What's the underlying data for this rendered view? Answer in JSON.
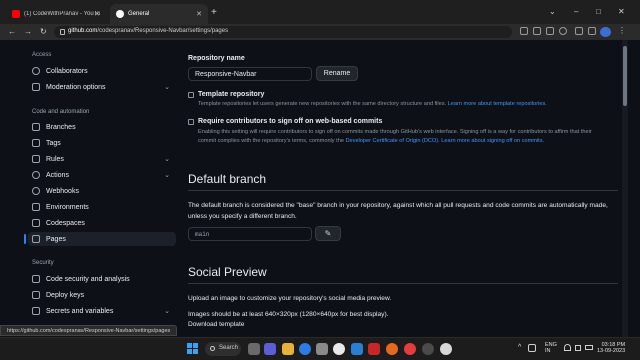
{
  "browser": {
    "tabs": [
      {
        "title": "(1) CodeWithPranav - YouTube",
        "fav": "youtube-icon",
        "color": "#ff0000"
      },
      {
        "title": "General",
        "fav": "github-icon",
        "color": "#ffffff"
      }
    ],
    "new_tab": "+",
    "window_controls": {
      "restore": "⌄",
      "minimize": "–",
      "maximize": "□",
      "close": "✕"
    },
    "nav": {
      "back": "←",
      "forward": "→",
      "reload": "↻"
    },
    "url_host": "github.com",
    "url_path": "/codespranav/Responsive-Navbar/settings/pages",
    "menu": "⋮"
  },
  "sidebar": {
    "access_heading": "Access",
    "code_heading": "Code and automation",
    "security_heading": "Security",
    "items": [
      {
        "label": "Collaborators",
        "icon": "people-icon"
      },
      {
        "label": "Moderation options",
        "icon": "report-icon",
        "chevron": "⌄"
      },
      {
        "label": "Branches",
        "icon": "branch-icon"
      },
      {
        "label": "Tags",
        "icon": "tag-icon"
      },
      {
        "label": "Rules",
        "icon": "rules-icon",
        "chevron": "⌄"
      },
      {
        "label": "Actions",
        "icon": "play-icon",
        "chevron": "⌄"
      },
      {
        "label": "Webhooks",
        "icon": "webhook-icon"
      },
      {
        "label": "Environments",
        "icon": "server-icon"
      },
      {
        "label": "Codespaces",
        "icon": "codespaces-icon"
      },
      {
        "label": "Pages",
        "icon": "browser-icon"
      },
      {
        "label": "Code security and analysis",
        "icon": "shield-icon"
      },
      {
        "label": "Deploy keys",
        "icon": "key-icon"
      },
      {
        "label": "Secrets and variables",
        "icon": "asterisk-icon",
        "chevron": "⌄"
      }
    ]
  },
  "main": {
    "repo_name_label": "Repository name",
    "repo_name_value": "Responsive-Navbar",
    "rename_button": "Rename",
    "template": {
      "title": "Template repository",
      "desc": "Template repositories let users generate new repositories with the same directory structure and files.",
      "link": "Learn more about template repositories."
    },
    "signoff": {
      "title": "Require contributors to sign off on web-based commits",
      "desc_1": "Enabling this setting will require contributors to sign off on commits made through GitHub's web interface. Signing off is a way for",
      "desc_2": "contributors to affirm that their commit complies with the repository's terms, commonly the",
      "link_dco": "Developer Certificate of Origin (DCO).",
      "link_learn": "Learn more about signing off on commits."
    },
    "default_branch": {
      "heading": "Default branch",
      "desc_1": "The default branch is considered the \"base\" branch in your repository, against which all pull requests and code commits are",
      "desc_2": "automatically made, unless you specify a different branch.",
      "branch": "main",
      "edit_icon": "pencil-icon"
    },
    "social_preview": {
      "heading": "Social Preview",
      "desc": "Upload an image to customize your repository's social media preview.",
      "size_note": "Images should be at least 640×320px (1280×640px for best display).",
      "download_link": "Download template"
    }
  },
  "status_url": "https://github.com/codespranav/Responsive-Navbar/settings/pages",
  "taskbar": {
    "search_label": "Search",
    "lang_1": "ENG",
    "lang_2": "IN",
    "time": "03:18 PM",
    "date": "13-09-2023"
  },
  "colors": {
    "accent": "#2f81f7",
    "link": "#4493f8",
    "bg": "#0d1117"
  }
}
